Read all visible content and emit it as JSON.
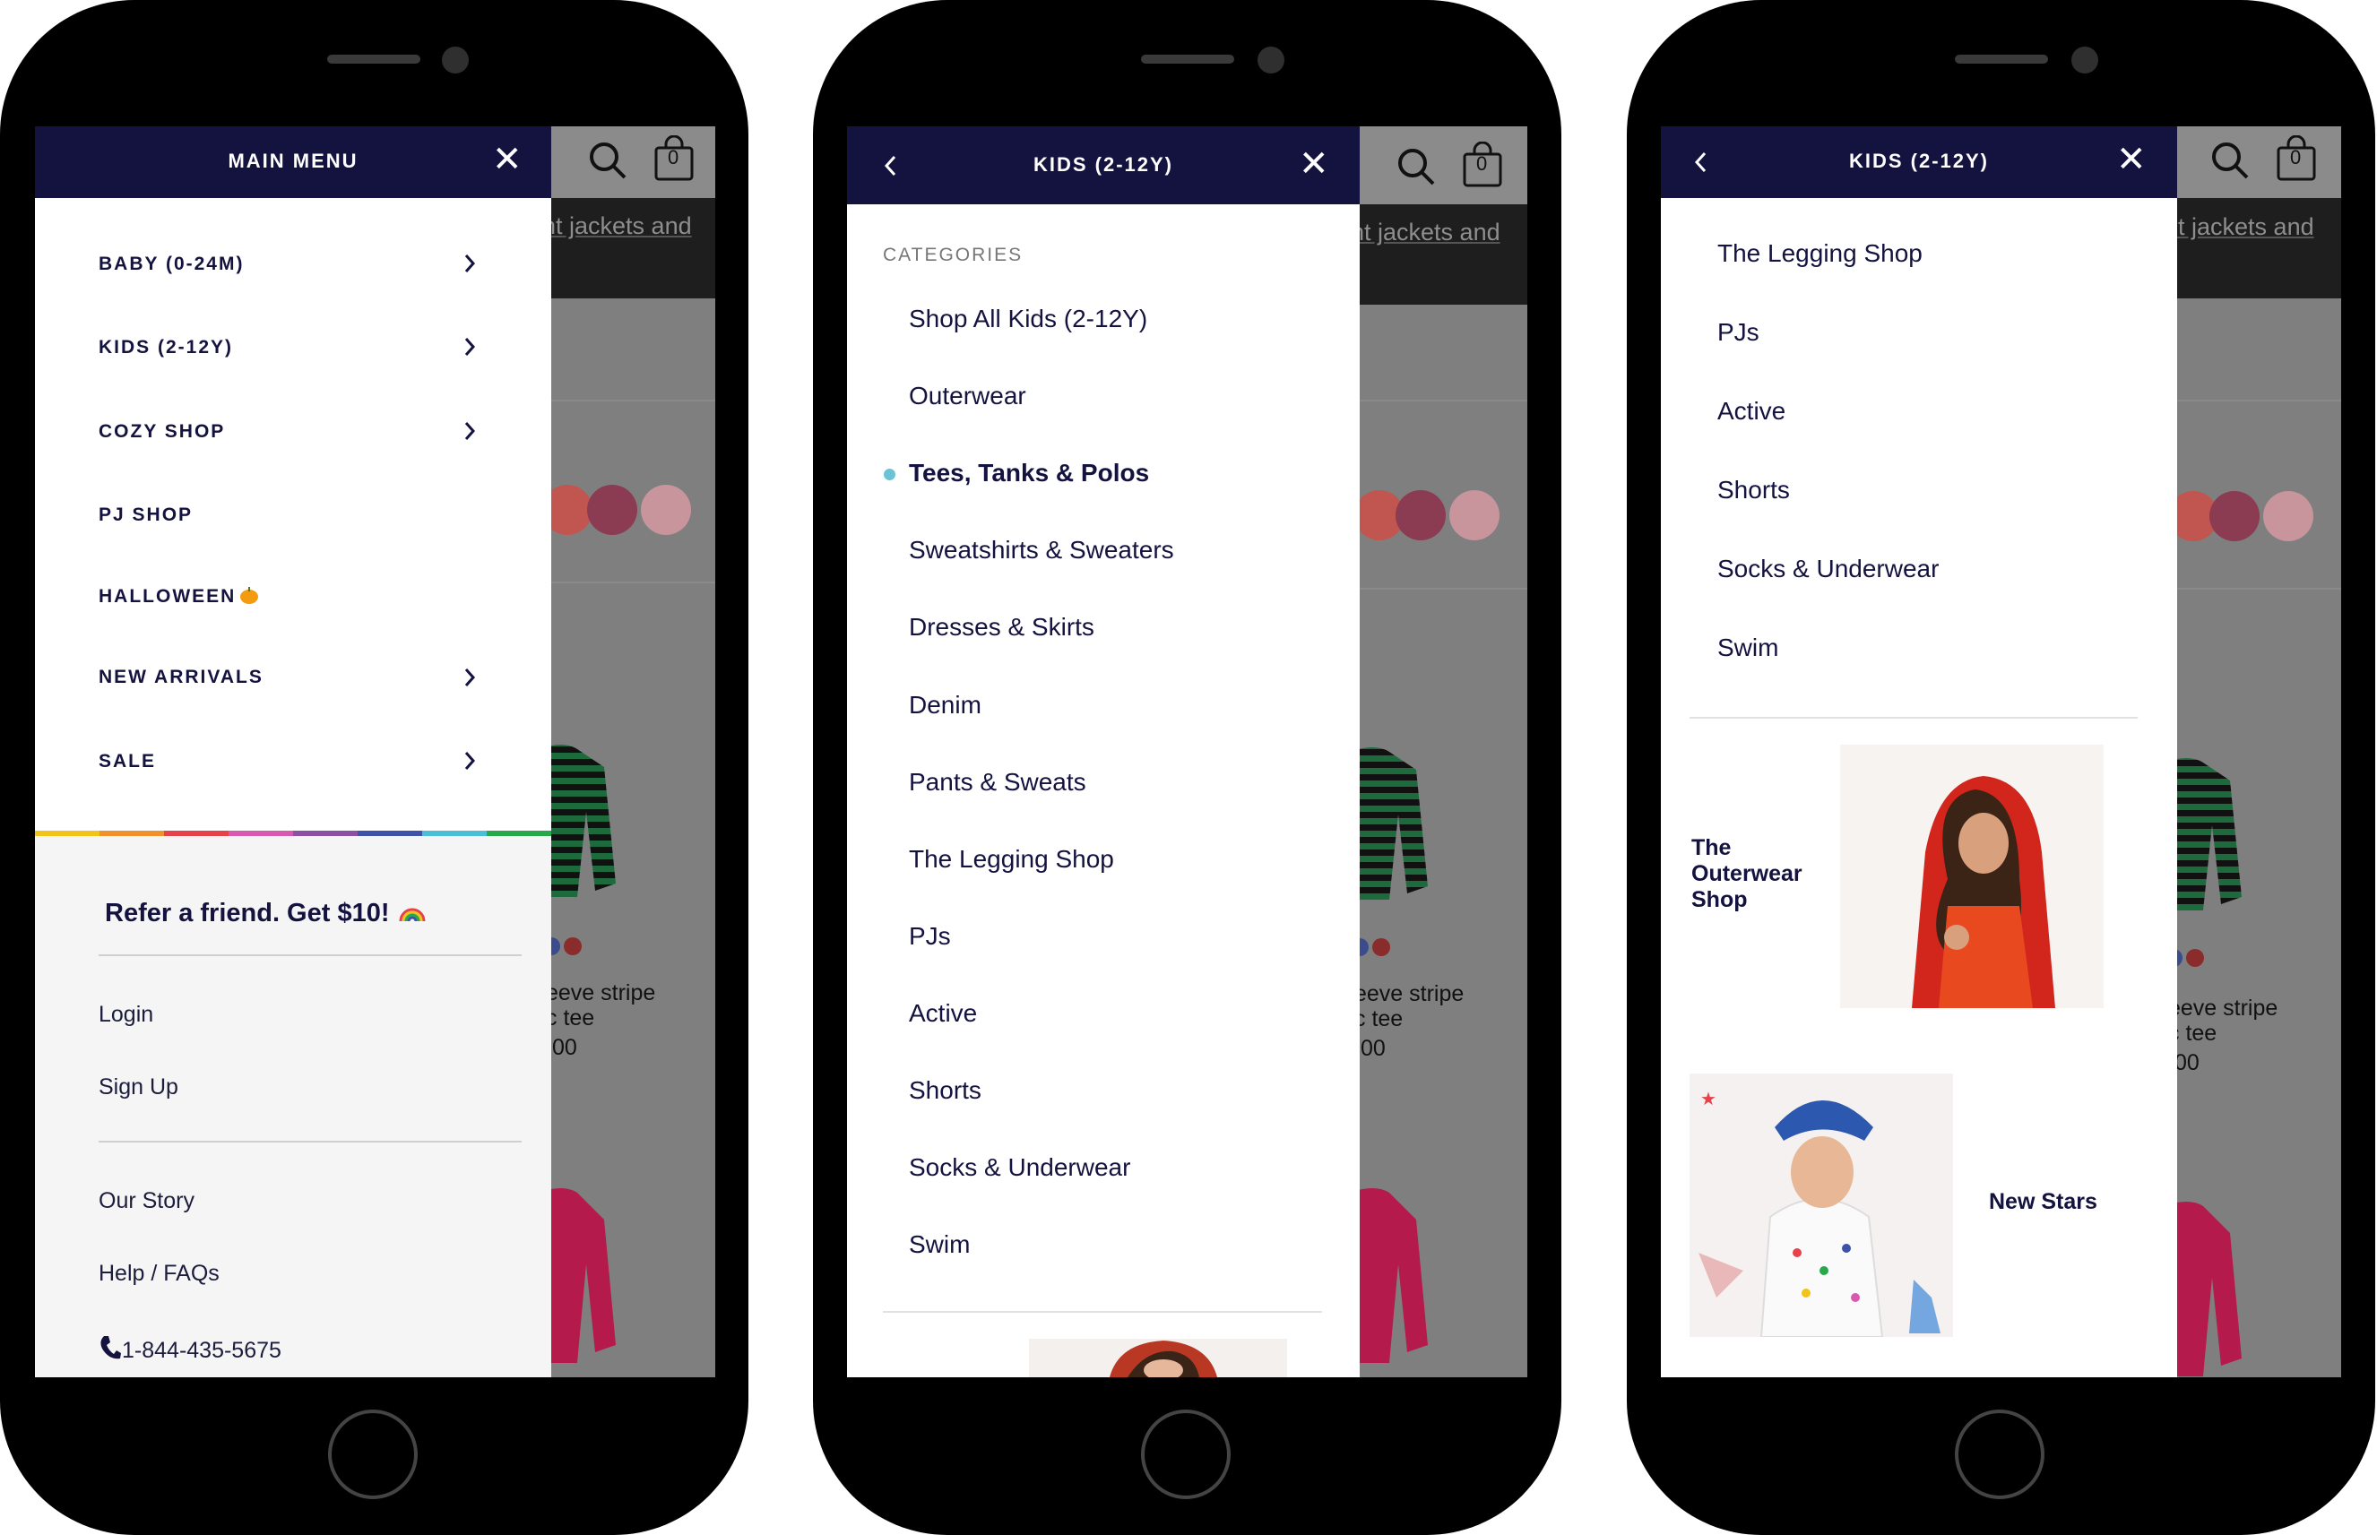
{
  "background_page": {
    "banner_text": "nt jackets and",
    "product_name_line1": "eeve stripe",
    "product_name_line2": "c tee",
    "product_price": ".00",
    "cart_count": "0",
    "colors": {
      "swatch_red": "#c0564f",
      "swatch_plum": "#8b3b52",
      "swatch_pink": "#c7959b"
    }
  },
  "phone1": {
    "header_title": "MAIN MENU",
    "items": [
      {
        "label": "BABY (0-24M)",
        "has_arrow": true
      },
      {
        "label": "KIDS (2-12Y)",
        "has_arrow": true
      },
      {
        "label": "COZY SHOP",
        "has_arrow": true
      },
      {
        "label": "PJ SHOP",
        "has_arrow": false
      },
      {
        "label": "HALLOWEEN",
        "has_arrow": false,
        "icon": "pumpkin-icon"
      },
      {
        "label": "NEW ARRIVALS",
        "has_arrow": true
      },
      {
        "label": "SALE",
        "has_arrow": true
      }
    ],
    "rainbow_colors": [
      "#f2c318",
      "#f0912b",
      "#e5424a",
      "#d85ab0",
      "#8c4fa6",
      "#3d52a8",
      "#4cbfd6",
      "#27a84a"
    ],
    "refer_text": "Refer a friend. Get $10!",
    "refer_icon": "rainbow-icon",
    "account": [
      "Login",
      "Sign Up"
    ],
    "info": [
      "Our Story",
      "Help / FAQs"
    ],
    "phone_icon": "phone-icon",
    "phone_number": "1-844-435-5675"
  },
  "phone2": {
    "header_title": "KIDS (2-12Y)",
    "section_label": "CATEGORIES",
    "categories": [
      "Shop All Kids (2-12Y)",
      "Outerwear",
      "Tees, Tanks & Polos",
      "Sweatshirts & Sweaters",
      "Dresses & Skirts",
      "Denim",
      "Pants & Sweats",
      "The Legging Shop",
      "PJs",
      "Active",
      "Shorts",
      "Socks & Underwear",
      "Swim"
    ],
    "selected_index": 2,
    "selected_dot_color": "#6cc3d5"
  },
  "phone3": {
    "header_title": "KIDS (2-12Y)",
    "categories": [
      "The Legging Shop",
      "PJs",
      "Active",
      "Shorts",
      "Socks & Underwear",
      "Swim"
    ],
    "promo1": {
      "line1": "The",
      "line2": "Outerwear",
      "line3": "Shop"
    },
    "promo2": {
      "label": "New Stars"
    }
  },
  "colors": {
    "header_navy": "#14123f",
    "drawer_bg": "#ffffff",
    "panel_grey": "#f5f5f5"
  }
}
